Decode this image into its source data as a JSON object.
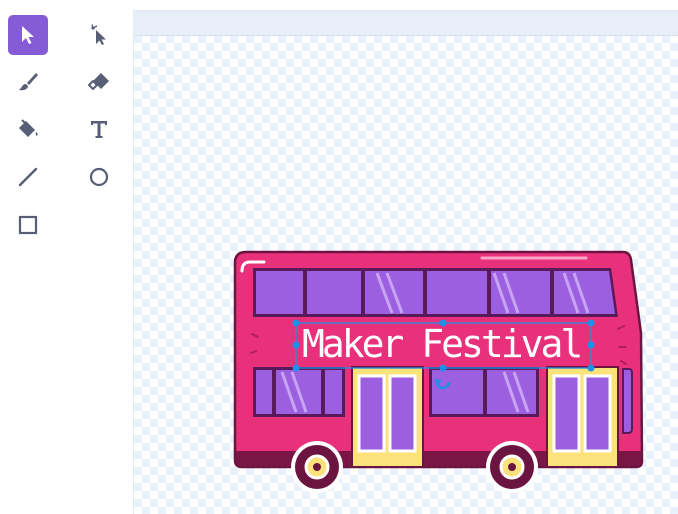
{
  "toolbar": {
    "tools": [
      {
        "id": "select",
        "icon": "arrow-pointer-icon",
        "selected": true
      },
      {
        "id": "reshape",
        "icon": "reshape-pointer-icon",
        "selected": false
      },
      {
        "id": "brush",
        "icon": "brush-icon",
        "selected": false
      },
      {
        "id": "eraser",
        "icon": "eraser-icon",
        "selected": false
      },
      {
        "id": "fill",
        "icon": "paint-bucket-icon",
        "selected": false
      },
      {
        "id": "text",
        "icon": "text-icon",
        "selected": false
      },
      {
        "id": "line",
        "icon": "line-icon",
        "selected": false
      },
      {
        "id": "circle",
        "icon": "circle-icon",
        "selected": false
      },
      {
        "id": "rectangle",
        "icon": "rectangle-icon",
        "selected": false
      }
    ]
  },
  "canvas": {
    "text_value": "Maker Festival",
    "colors": {
      "accent": "#855cd6",
      "bus_body": "#e8317a",
      "bus_window": "#9b5fe0",
      "bus_door": "#fbe27a",
      "selection": "#1e90e8"
    }
  }
}
